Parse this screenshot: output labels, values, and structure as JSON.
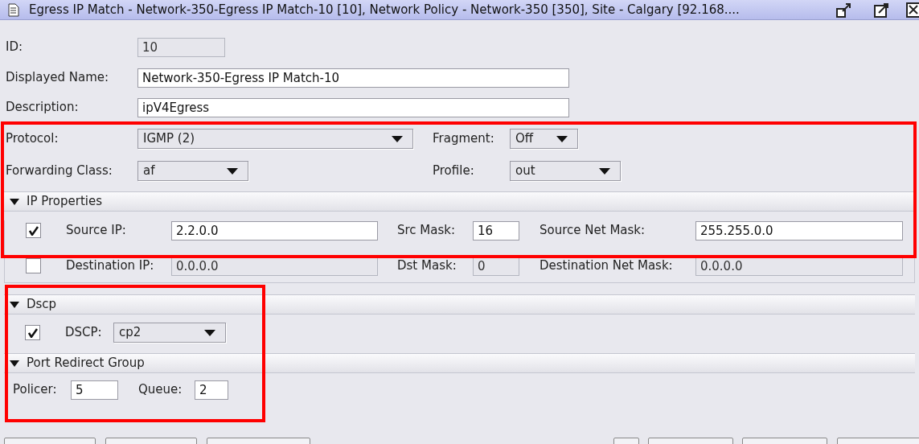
{
  "window": {
    "title": "Egress IP Match - Network-350-Egress IP Match-10 [10], Network Policy - Network-350 [350], Site - Calgary [92.168...."
  },
  "fields": [
    {
      "label": "ID:",
      "value": "10",
      "disabled": true
    },
    {
      "label": "Displayed Name:",
      "value": "Network-350-Egress IP Match-10",
      "disabled": false
    },
    {
      "label": "Description:",
      "value": "ipV4Egress",
      "disabled": false
    }
  ],
  "protocol": {
    "label": "Protocol:",
    "value": "IGMP (2)"
  },
  "fragment": {
    "label": "Fragment:",
    "value": "Off"
  },
  "forwarding_class": {
    "label": "Forwarding Class:",
    "value": "af"
  },
  "profile": {
    "label": "Profile:",
    "value": "out"
  },
  "ip_properties": {
    "title": "IP Properties",
    "expanded": true,
    "rows": [
      {
        "checked": true,
        "ip_label": "Source IP:",
        "ip": "2.2.0.0",
        "mask_label": "Src Mask:",
        "mask": "16",
        "net_mask_label": "Source Net Mask:",
        "net_mask": "255.255.0.0"
      },
      {
        "checked": false,
        "ip_label": "Destination IP:",
        "ip": "0.0.0.0",
        "mask_label": "Dst Mask:",
        "mask": "0",
        "net_mask_label": "Destination Net Mask:",
        "net_mask": "0.0.0.0"
      }
    ]
  },
  "dscp": {
    "title": "Dscp",
    "expanded": true,
    "checked": true,
    "label": "DSCP:",
    "value": "cp2"
  },
  "port_redirect_group": {
    "title": "Port Redirect Group",
    "expanded": true,
    "policer_label": "Policer:",
    "policer": "5",
    "queue_label": "Queue:",
    "queue": "2"
  }
}
